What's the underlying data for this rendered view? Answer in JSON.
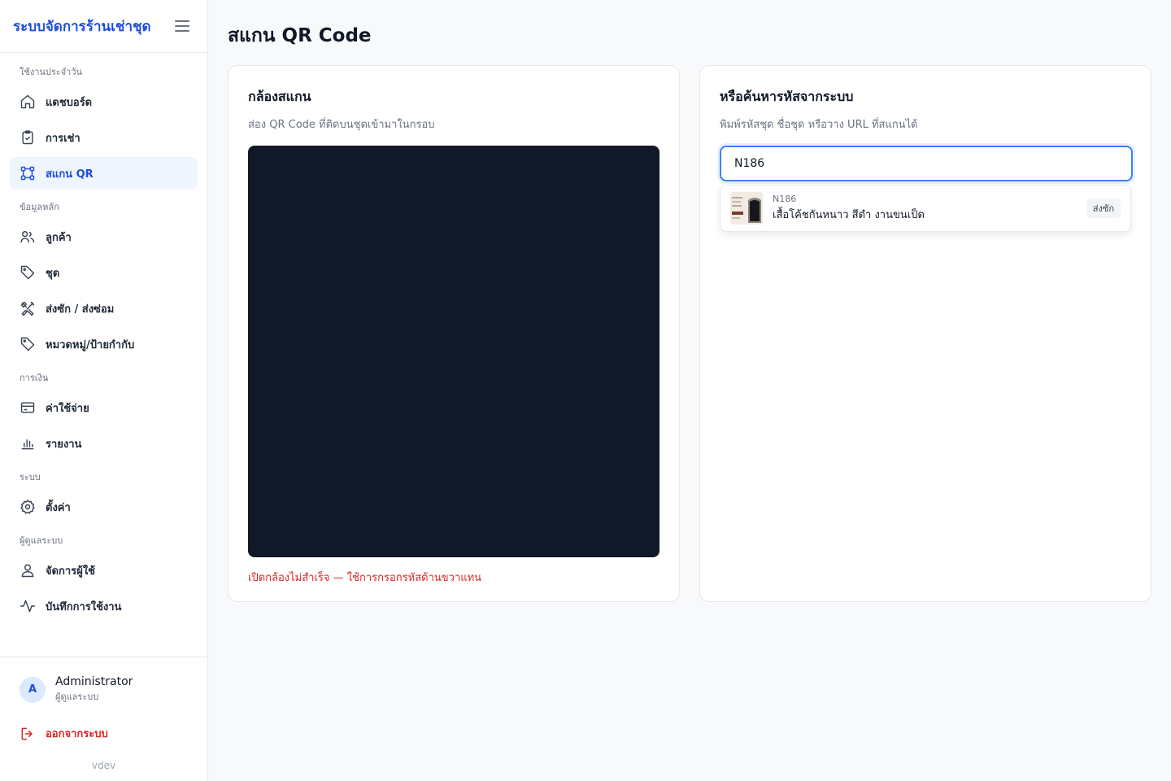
{
  "brand": {
    "title": "ระบบจัดการร้านเช่าชุด"
  },
  "sidebar": {
    "sections": [
      {
        "label": "ใช้งานประจำวัน",
        "items": [
          {
            "label": "แดชบอร์ด",
            "icon": "home-icon"
          },
          {
            "label": "การเช่า",
            "icon": "clipboard-check-icon"
          },
          {
            "label": "สแกน QR",
            "icon": "qr-scan-icon",
            "active": true
          }
        ]
      },
      {
        "label": "ข้อมูลหลัก",
        "items": [
          {
            "label": "ลูกค้า",
            "icon": "users-icon"
          },
          {
            "label": "ชุด",
            "icon": "tag-icon"
          },
          {
            "label": "ส่งซัก / ส่งซ่อม",
            "icon": "tools-icon"
          },
          {
            "label": "หมวดหมู่/ป้ายกำกับ",
            "icon": "tag-outline-icon"
          }
        ]
      },
      {
        "label": "การเงิน",
        "items": [
          {
            "label": "ค่าใช้จ่าย",
            "icon": "credit-card-icon"
          },
          {
            "label": "รายงาน",
            "icon": "bar-chart-icon"
          }
        ]
      },
      {
        "label": "ระบบ",
        "items": [
          {
            "label": "ตั้งค่า",
            "icon": "gear-icon"
          }
        ]
      },
      {
        "label": "ผู้ดูแลระบบ",
        "items": [
          {
            "label": "จัดการผู้ใช้",
            "icon": "user-icon"
          },
          {
            "label": "บันทึกการใช้งาน",
            "icon": "activity-icon"
          }
        ]
      }
    ]
  },
  "user": {
    "initial": "A",
    "name": "Administrator",
    "role": "ผู้ดูแลระบบ"
  },
  "logout": {
    "label": "ออกจากระบบ"
  },
  "version": "vdev",
  "page": {
    "title": "สแกน QR Code"
  },
  "camera_card": {
    "title": "กล้องสแกน",
    "subtitle": "ส่อง QR Code ที่ติดบนชุดเข้ามาในกรอบ",
    "error": "เปิดกล้องไม่สำเร็จ — ใช้การกรอกรหัสด้านขวาแทน"
  },
  "search_card": {
    "title": "หรือค้นหารหัสจากระบบ",
    "subtitle": "พิมพ์รหัสชุด ชื่อชุด หรือวาง URL ที่สแกนได้",
    "value": "N186"
  },
  "result": {
    "code": "N186",
    "name": "เสื้อโค้ชกันหนาว สีดำ งานขนเป็ด",
    "status": "ส่งซัก"
  },
  "colors": {
    "accent": "#1d4ed8",
    "active_bg": "#eff4ff",
    "danger": "#dc2626",
    "camera_bg": "#111827"
  }
}
